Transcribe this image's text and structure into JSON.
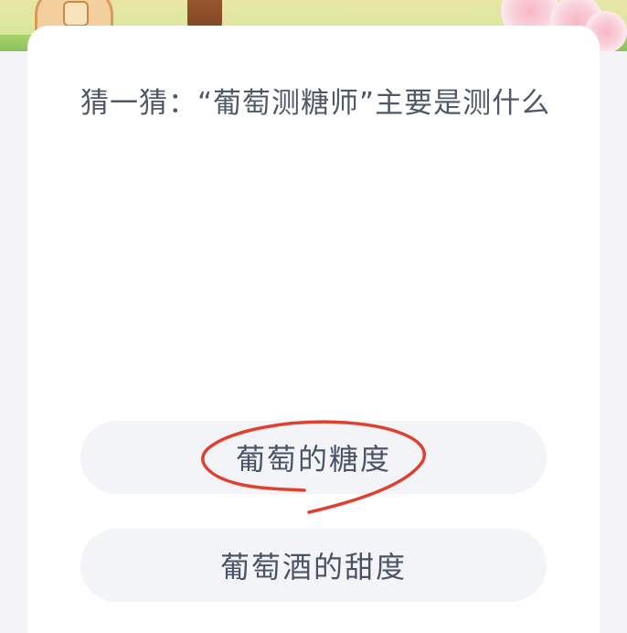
{
  "quiz": {
    "question": "猜一猜：“葡萄测糖师”主要是测什么",
    "options": [
      {
        "label": "葡萄的糖度"
      },
      {
        "label": "葡萄酒的甜度"
      }
    ]
  },
  "colors": {
    "page_background": "#f4f4f6",
    "card_background": "#ffffff",
    "option_background": "#f3f4f7",
    "text": "#4e5869",
    "annotation_stroke": "#e0402f"
  }
}
